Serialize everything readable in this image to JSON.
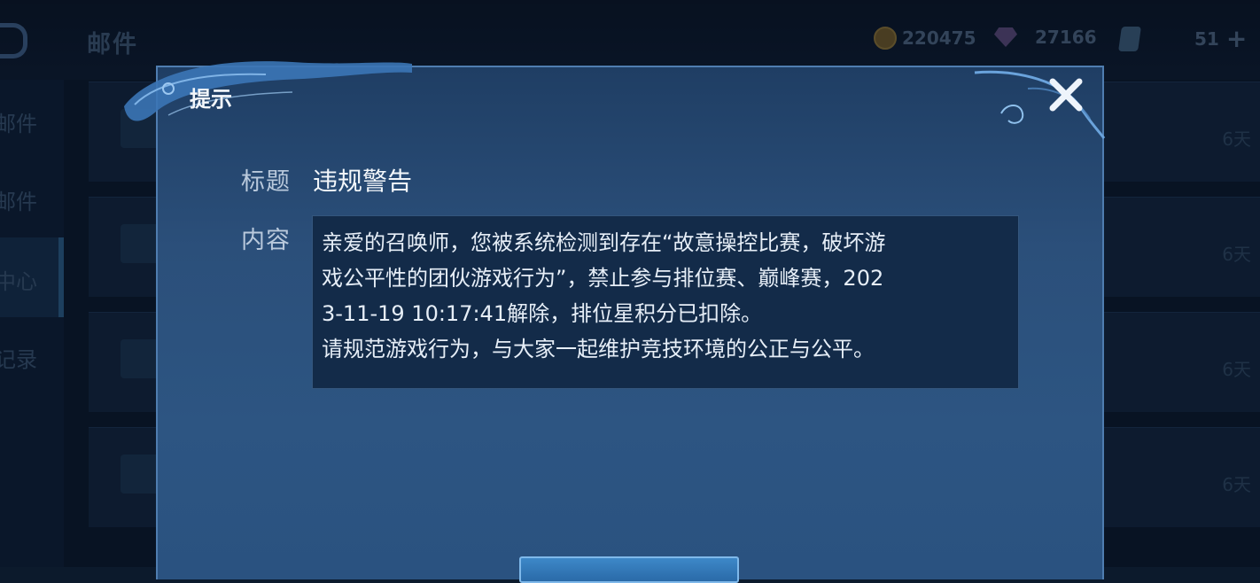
{
  "header": {
    "title": "邮件",
    "gold_amount": "220475",
    "gem_amount": "27166",
    "extra_count": "51",
    "icons": [
      "gold-coin-icon",
      "diamond-icon",
      "card-icon",
      "plus-icon"
    ]
  },
  "sidebar": {
    "items": [
      {
        "label": "邮件"
      },
      {
        "label": "邮件"
      },
      {
        "label": "中心"
      },
      {
        "label": "记录"
      }
    ]
  },
  "mail_list": {
    "rows": [
      {
        "age": "6天"
      },
      {
        "age": "6天"
      },
      {
        "age": "6天"
      },
      {
        "age": "6天"
      }
    ]
  },
  "dialog": {
    "title": "提示",
    "subject_label": "标题",
    "subject_value": "违规警告",
    "content_label": "内容",
    "content_lines": [
      "亲爱的召唤师，您被系统检测到存在“故意操控比赛，破坏游",
      "戏公平性的团伙游戏行为”，禁止参与排位赛、巅峰赛，202",
      "3-11-19 10:17:41解除，排位星积分已扣除。",
      "请规范游戏行为，与大家一起维护竞技环境的公正与公平。"
    ]
  },
  "colors": {
    "dialog_bg": "#2b4f7a",
    "content_bg": "#132b49",
    "text": "#e6eef7"
  }
}
